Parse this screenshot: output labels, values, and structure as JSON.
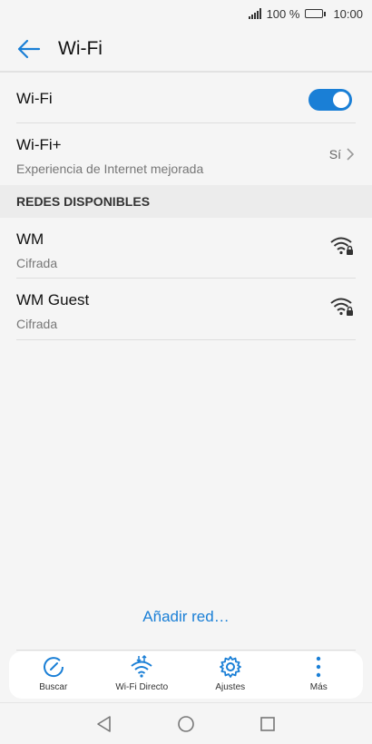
{
  "status_bar": {
    "battery_percent": "100 %",
    "time": "10:00"
  },
  "header": {
    "title": "Wi-Fi"
  },
  "wifi_toggle": {
    "label": "Wi-Fi",
    "enabled": true
  },
  "wifi_plus": {
    "title": "Wi-Fi+",
    "subtitle": "Experiencia de Internet mejorada",
    "value": "Sí"
  },
  "available_networks": {
    "header": "REDES DISPONIBLES",
    "networks": [
      {
        "name": "WM",
        "security": "Cifrada"
      },
      {
        "name": "WM Guest",
        "security": "Cifrada"
      }
    ]
  },
  "add_network": {
    "label": "Añadir red…"
  },
  "bottom_bar": {
    "items": [
      {
        "label": "Buscar",
        "icon": "refresh-icon"
      },
      {
        "label": "Wi-Fi Directo",
        "icon": "wifi-direct-icon"
      },
      {
        "label": "Ajustes",
        "icon": "gear-icon"
      },
      {
        "label": "Más",
        "icon": "more-vertical-icon"
      }
    ]
  },
  "colors": {
    "accent": "#1a7fd6",
    "text": "#111111",
    "subtext": "#777777"
  }
}
